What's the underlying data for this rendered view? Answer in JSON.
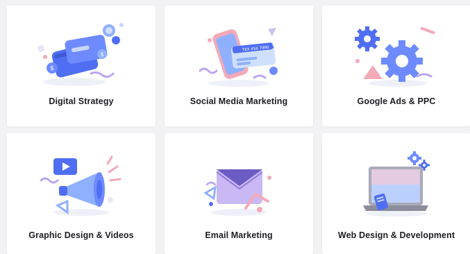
{
  "services": [
    {
      "label": "Digital Strategy",
      "icon": "money-cards-icon"
    },
    {
      "label": "Social Media Marketing",
      "icon": "phone-card-icon"
    },
    {
      "label": "Google Ads & PPC",
      "icon": "gears-icon"
    },
    {
      "label": "Graphic Design & Videos",
      "icon": "megaphone-icon"
    },
    {
      "label": "Email Marketing",
      "icon": "envelope-icon"
    },
    {
      "label": "Web Design & Development",
      "icon": "laptop-icon"
    }
  ],
  "illustration_text": {
    "phone_card": "TEX 456 7890"
  },
  "colors": {
    "blue": "#4a6cf0",
    "light_blue": "#8fb0ff",
    "pink": "#f4a9b8",
    "lavender": "#b9a6f0",
    "background": "#f2f2f4",
    "card": "#ffffff",
    "text": "#1d1d22"
  }
}
